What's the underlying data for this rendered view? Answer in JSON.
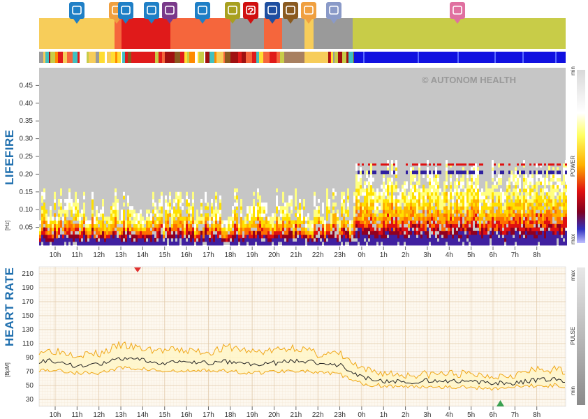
{
  "top_icons": [
    {
      "name": "meeting-icon",
      "label": "",
      "color": "#1f7fc6"
    },
    {
      "name": "meal-icon",
      "label": "",
      "color": "#f0a040"
    },
    {
      "name": "meeting-icon",
      "label": "",
      "color": "#1f7fc6"
    },
    {
      "name": "mind-icon",
      "label": "",
      "color": "#1f7fc6"
    },
    {
      "name": "relax-icon",
      "label": "",
      "color": "#7a3a8a"
    },
    {
      "name": "meeting-icon",
      "label": "",
      "color": "#1f7fc6"
    },
    {
      "name": "walk-icon",
      "label": "",
      "color": "#a8a020"
    },
    {
      "name": "unknown-icon",
      "label": "?",
      "color": "#d01010"
    },
    {
      "name": "computer-icon",
      "label": "",
      "color": "#1f4fa0"
    },
    {
      "name": "sport-icon",
      "label": "",
      "color": "#8a5a20"
    },
    {
      "name": "meal-icon",
      "label": "",
      "color": "#f0a040"
    },
    {
      "name": "screen-icon",
      "label": "",
      "color": "#8a9ac8"
    },
    {
      "name": "sleep-icon",
      "label": "",
      "color": "#e070a0"
    }
  ],
  "activity_colors": {
    "yellow": "#f7cd5a",
    "red": "#e01a1a",
    "orange": "#f5663c",
    "gray": "#9a9a9a",
    "green": "#c8cc48",
    "brown": "#8a5a20",
    "blue": "#1010e0"
  },
  "lifefire": {
    "title": "LIFEFIRE",
    "unit": "[Hz]",
    "y_ticks": [
      "0.45",
      "0.40",
      "0.35",
      "0.30",
      "0.25",
      "0.20",
      "0.15",
      "0.10",
      "0.05"
    ],
    "y_values": [
      0.45,
      0.4,
      0.35,
      0.3,
      0.25,
      0.2,
      0.15,
      0.1,
      0.05
    ],
    "ylim": [
      0,
      0.5
    ],
    "scale_min": "min",
    "scale_power": "POWER",
    "scale_max": "max",
    "watermark": "© AUTONOM HEALTH"
  },
  "heart": {
    "title": "HEART RATE",
    "unit": "[BpM]",
    "y_ticks": [
      "210",
      "190",
      "170",
      "150",
      "130",
      "110",
      "90",
      "70",
      "50",
      "30"
    ],
    "y_values": [
      210,
      190,
      170,
      150,
      130,
      110,
      90,
      70,
      50,
      30
    ],
    "ylim": [
      20,
      220
    ],
    "scale_max": "max",
    "scale_pulse": "PULSE",
    "scale_min": "min"
  },
  "x_ticks": [
    "10h",
    "11h",
    "12h",
    "13h",
    "14h",
    "15h",
    "16h",
    "17h",
    "18h",
    "19h",
    "20h",
    "21h",
    "22h",
    "23h",
    "0h",
    "1h",
    "2h",
    "3h",
    "4h",
    "5h",
    "6h",
    "7h",
    "8h"
  ],
  "chart_data": [
    {
      "type": "heatmap",
      "title": "LIFEFIRE",
      "ylabel": "[Hz]",
      "x": [
        "10h",
        "11h",
        "12h",
        "13h",
        "14h",
        "15h",
        "16h",
        "17h",
        "18h",
        "19h",
        "20h",
        "21h",
        "22h",
        "23h",
        "0h",
        "1h",
        "2h",
        "3h",
        "4h",
        "5h",
        "6h",
        "7h",
        "8h"
      ],
      "y_ticks": [
        0.05,
        0.1,
        0.15,
        0.2,
        0.25,
        0.3,
        0.35,
        0.4,
        0.45
      ],
      "ylim": [
        0,
        0.5
      ],
      "legend": [
        "min",
        "POWER",
        "max"
      ]
    },
    {
      "type": "line",
      "title": "HEART RATE",
      "ylabel": "[BpM]",
      "categories": [
        "10h",
        "11h",
        "12h",
        "13h",
        "14h",
        "15h",
        "16h",
        "17h",
        "18h",
        "19h",
        "20h",
        "21h",
        "22h",
        "23h",
        "0h",
        "1h",
        "2h",
        "3h",
        "4h",
        "5h",
        "6h",
        "7h",
        "8h"
      ],
      "ylim": [
        20,
        220
      ],
      "series": [
        {
          "name": "",
          "values": [
            85,
            78,
            80,
            88,
            86,
            82,
            84,
            82,
            84,
            80,
            82,
            86,
            82,
            80,
            62,
            56,
            55,
            57,
            56,
            55,
            53,
            54,
            58
          ]
        },
        {
          "name": "",
          "values": [
            100,
            95,
            95,
            108,
            102,
            100,
            100,
            98,
            105,
            98,
            100,
            105,
            95,
            95,
            72,
            68,
            65,
            66,
            67,
            66,
            64,
            66,
            72
          ]
        },
        {
          "name": "",
          "values": [
            72,
            68,
            68,
            75,
            74,
            70,
            70,
            72,
            70,
            68,
            70,
            72,
            68,
            66,
            52,
            50,
            48,
            49,
            48,
            47,
            46,
            48,
            50
          ]
        }
      ]
    }
  ]
}
